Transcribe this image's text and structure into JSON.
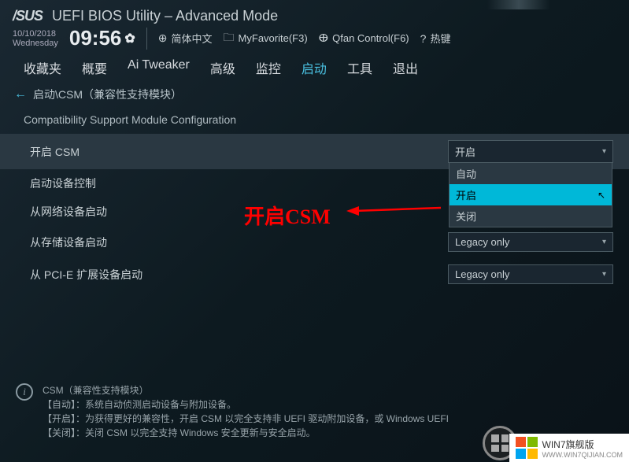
{
  "header": {
    "brand": "/SUS",
    "title": "UEFI BIOS Utility – Advanced Mode",
    "date": "10/10/2018",
    "day": "Wednesday",
    "time": "09:56",
    "language": "简体中文",
    "favorite": "MyFavorite(F3)",
    "qfan": "Qfan Control(F6)",
    "hotkey": "热键"
  },
  "tabs": [
    {
      "label": "收藏夹",
      "active": false
    },
    {
      "label": "概要",
      "active": false
    },
    {
      "label": "Ai Tweaker",
      "active": false
    },
    {
      "label": "高级",
      "active": false
    },
    {
      "label": "监控",
      "active": false
    },
    {
      "label": "启动",
      "active": true
    },
    {
      "label": "工具",
      "active": false
    },
    {
      "label": "退出",
      "active": false
    }
  ],
  "breadcrumb": "启动\\CSM（兼容性支持模块）",
  "section_title": "Compatibility Support Module Configuration",
  "settings": [
    {
      "label": "开启 CSM",
      "value": "开启",
      "highlighted": true,
      "open": true
    },
    {
      "label": "启动设备控制",
      "value": ""
    },
    {
      "label": "从网络设备启动",
      "value": ""
    },
    {
      "label": "从存储设备启动",
      "value": "Legacy only"
    },
    {
      "label": "从 PCI-E 扩展设备启动",
      "value": "Legacy only"
    }
  ],
  "dropdown_options": [
    "自动",
    "开启",
    "关闭"
  ],
  "dropdown_selected": "开启",
  "annotation_text": "开启CSM",
  "help": {
    "title": "CSM（兼容性支持模块）",
    "line1": "【自动】：系统自动侦测启动设备与附加设备。",
    "line2": "【开启】：为获得更好的兼容性，开启 CSM 以完全支持非 UEFI 驱动附加设备，或 Windows UEFI",
    "line3": "【关闭】：关闭 CSM 以完全支持 Windows 安全更新与安全启动。"
  },
  "watermark": {
    "text": "WIN7旗舰版",
    "url": "WWW.WIN7QIJIAN.COM"
  }
}
